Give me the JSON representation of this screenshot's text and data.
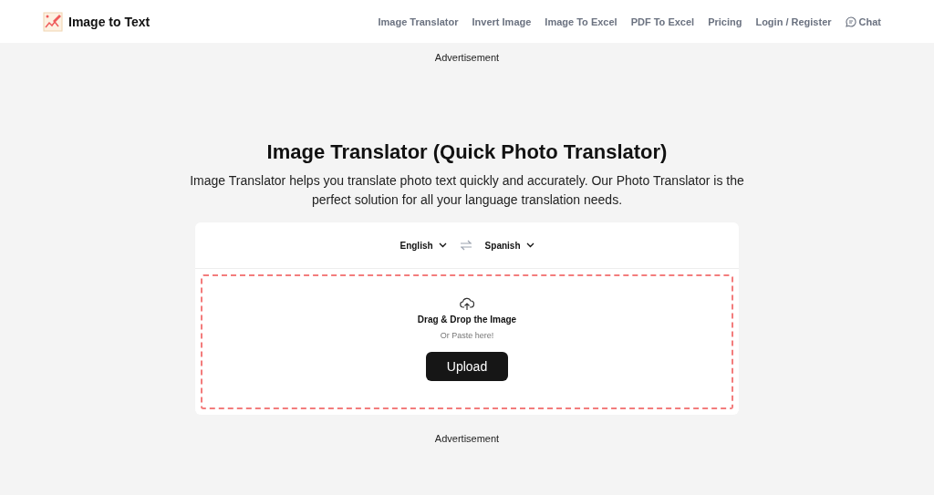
{
  "header": {
    "logo_text": "Image to Text",
    "nav": [
      "Image Translator",
      "Invert Image",
      "Image To Excel",
      "PDF To Excel",
      "Pricing",
      "Login / Register"
    ],
    "chat": "Chat"
  },
  "ad_top": "Advertisement",
  "title": "Image Translator (Quick Photo Translator)",
  "description": "Image Translator helps you translate photo text quickly and accurately. Our Photo Translator is the perfect solution for all your language translation needs.",
  "translator": {
    "source_language": "English",
    "target_language": "Spanish",
    "drop_title": "Drag & Drop the Image",
    "drop_hint": "Or Paste here!",
    "upload_button": "Upload"
  },
  "ad_bottom": "Advertisement"
}
